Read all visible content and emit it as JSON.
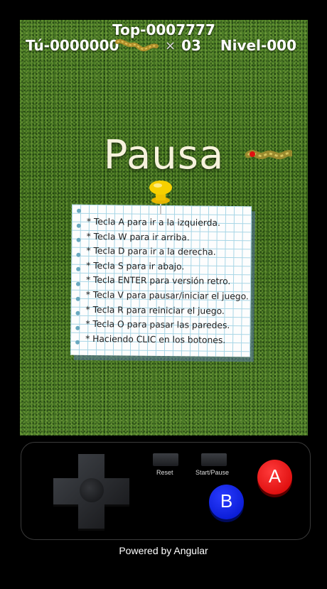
{
  "hud": {
    "top_score": "Top-0007777",
    "your_score": "Tú-0000000",
    "lives_multiplier": "×",
    "lives_count": "03",
    "level": "Nivel-000"
  },
  "pause": {
    "title": "Pausa"
  },
  "instructions": [
    "* Tecla A para ir a la izquierda.",
    "* Tecla W para ir arriba.",
    "* Tecla D para ir a la derecha.",
    "* Tecla S para ir abajo.",
    "* Tecla ENTER para versión retro.",
    "* Tecla V para pausar/iniciar el juego.",
    "* Tecla R para reiniciar el juego.",
    "* Tecla O para pasar las paredes.",
    "* Haciendo CLIC en los botones."
  ],
  "controls": {
    "reset_label": "Reset",
    "start_pause_label": "Start/Pause",
    "a_label": "A",
    "b_label": "B"
  },
  "footer": "Powered by Angular",
  "colors": {
    "grass": "#3d6a1e",
    "button_a": "#e00000",
    "button_b": "#0a1ee0",
    "notebook_grid": "#a8d6e6"
  }
}
